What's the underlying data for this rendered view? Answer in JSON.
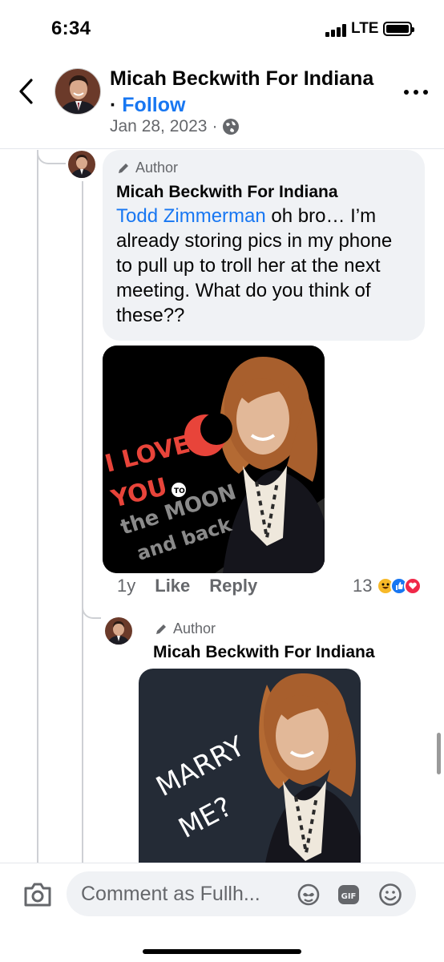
{
  "status_bar": {
    "time": "6:34",
    "network": "LTE"
  },
  "header": {
    "title": "Micah Beckwith For Indiana",
    "separator": " · ",
    "follow_label": "Follow",
    "date": "Jan 28, 2023",
    "dot": "·"
  },
  "comment": {
    "badge": "Author",
    "author": "Micah Beckwith For Indiana",
    "mention": "Todd Zimmerman",
    "text": " oh bro… I’m already storing pics in my phone to pull up to troll her at the next meeting. What do you think of these??",
    "sticker_text": [
      "I LOVE",
      "YOU",
      "TO",
      "the MOON",
      "and back"
    ],
    "time": "1y",
    "like_label": "Like",
    "reply_label": "Reply",
    "reaction_count": "13"
  },
  "reply": {
    "badge": "Author",
    "author": "Micah Beckwith For Indiana",
    "sticker_text": [
      "MARRY",
      "ME?"
    ]
  },
  "composer": {
    "placeholder": "Comment as Fullh...",
    "gif_label": "GIF"
  },
  "colors": {
    "accent": "#1877f2",
    "bubble": "#f0f2f5",
    "muted": "#65676b"
  }
}
